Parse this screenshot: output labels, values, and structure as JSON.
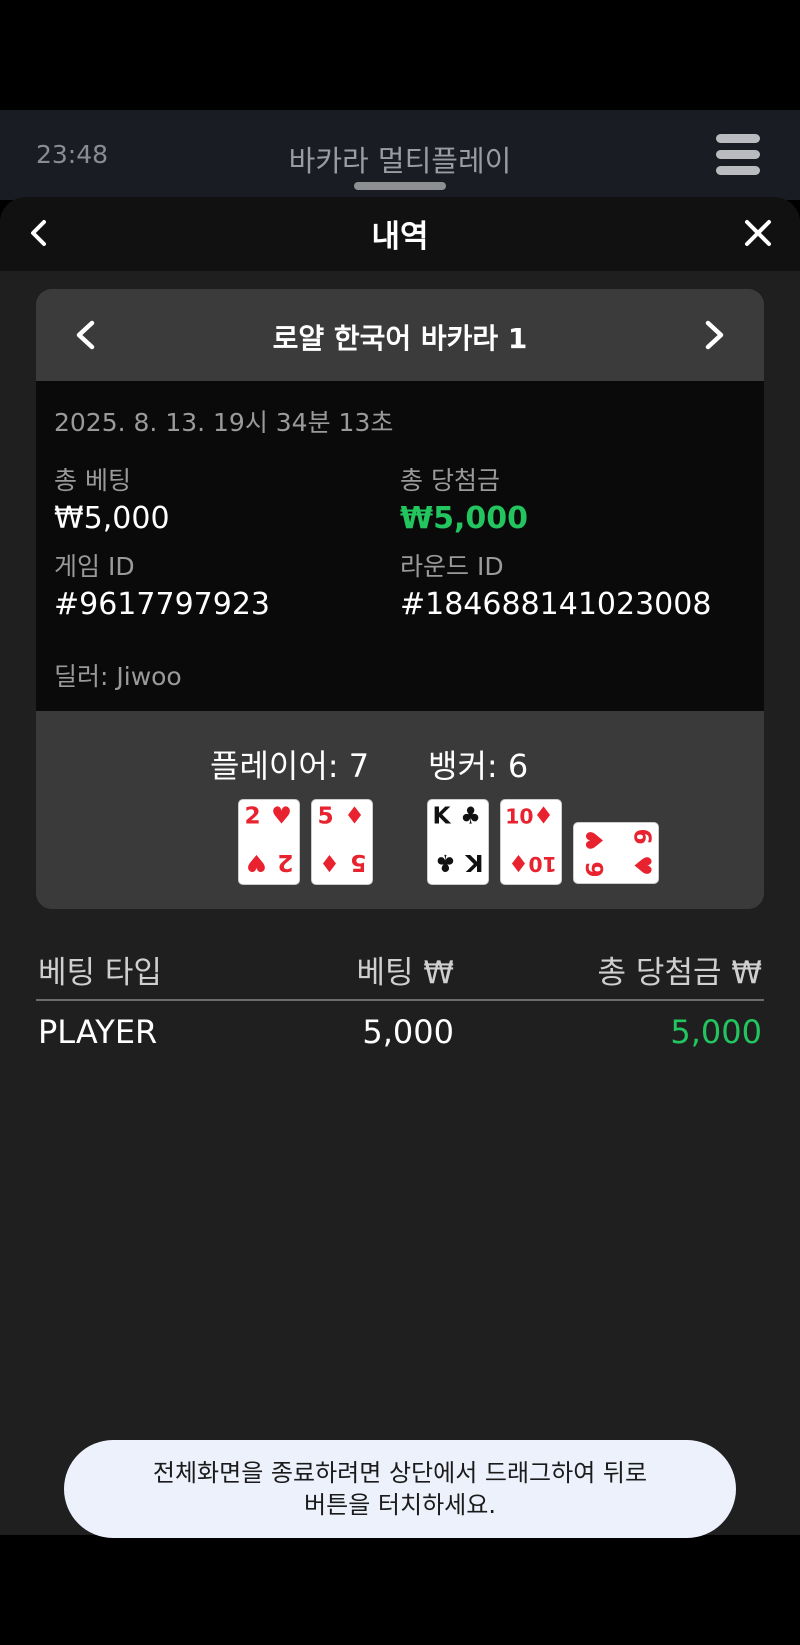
{
  "topbar": {
    "time": "23:48",
    "title": "바카라 멀티플레이",
    "menu_icon": "hamburger-menu-icon"
  },
  "sheet": {
    "heading": "내역",
    "back_icon": "chevron-left-icon",
    "close_icon": "close-icon"
  },
  "card": {
    "table_name": "로얄 한국어 바카라 1",
    "datetime": "2025. 8. 13. 19시 34분 13초",
    "total_bet_label": "총 베팅",
    "total_bet_value": "₩5,000",
    "total_win_label": "총 당첨금",
    "total_win_value": "₩5,000",
    "game_id_label": "게임 ID",
    "game_id_value": "#9617797923",
    "round_id_label": "라운드 ID",
    "round_id_value": "#184688141023008",
    "dealer": "딜러: Jiwoo",
    "player_score": "플레이어: 7",
    "banker_score": "뱅커: 6",
    "player_cards": [
      {
        "rank": "2",
        "suit": "hearts",
        "suit_symbol": "♥",
        "color": "#e8222e"
      },
      {
        "rank": "5",
        "suit": "diamonds",
        "suit_symbol": "♦",
        "color": "#e8222e"
      }
    ],
    "banker_cards": [
      {
        "rank": "K",
        "suit": "clubs",
        "suit_symbol": "♣",
        "color": "#111111"
      },
      {
        "rank": "10",
        "suit": "diamonds",
        "suit_symbol": "♦",
        "color": "#e8222e"
      },
      {
        "rank": "6",
        "suit": "hearts",
        "suit_symbol": "♥",
        "color": "#e8222e",
        "orientation": "sideways"
      }
    ]
  },
  "bets": {
    "columns": [
      "베팅 타입",
      "베팅 ₩",
      "총 당첨금 ₩"
    ],
    "rows": [
      {
        "type": "PLAYER",
        "bet": "5,000",
        "win": "5,000"
      }
    ]
  },
  "toast": {
    "line1": "전체화면을 종료하려면 상단에서 드래그하여 뒤로",
    "line2": "버튼을 터치하세요."
  },
  "colors": {
    "win_green": "#22c55e",
    "card_red": "#e8222e",
    "toast_bg": "#edf1fb"
  }
}
